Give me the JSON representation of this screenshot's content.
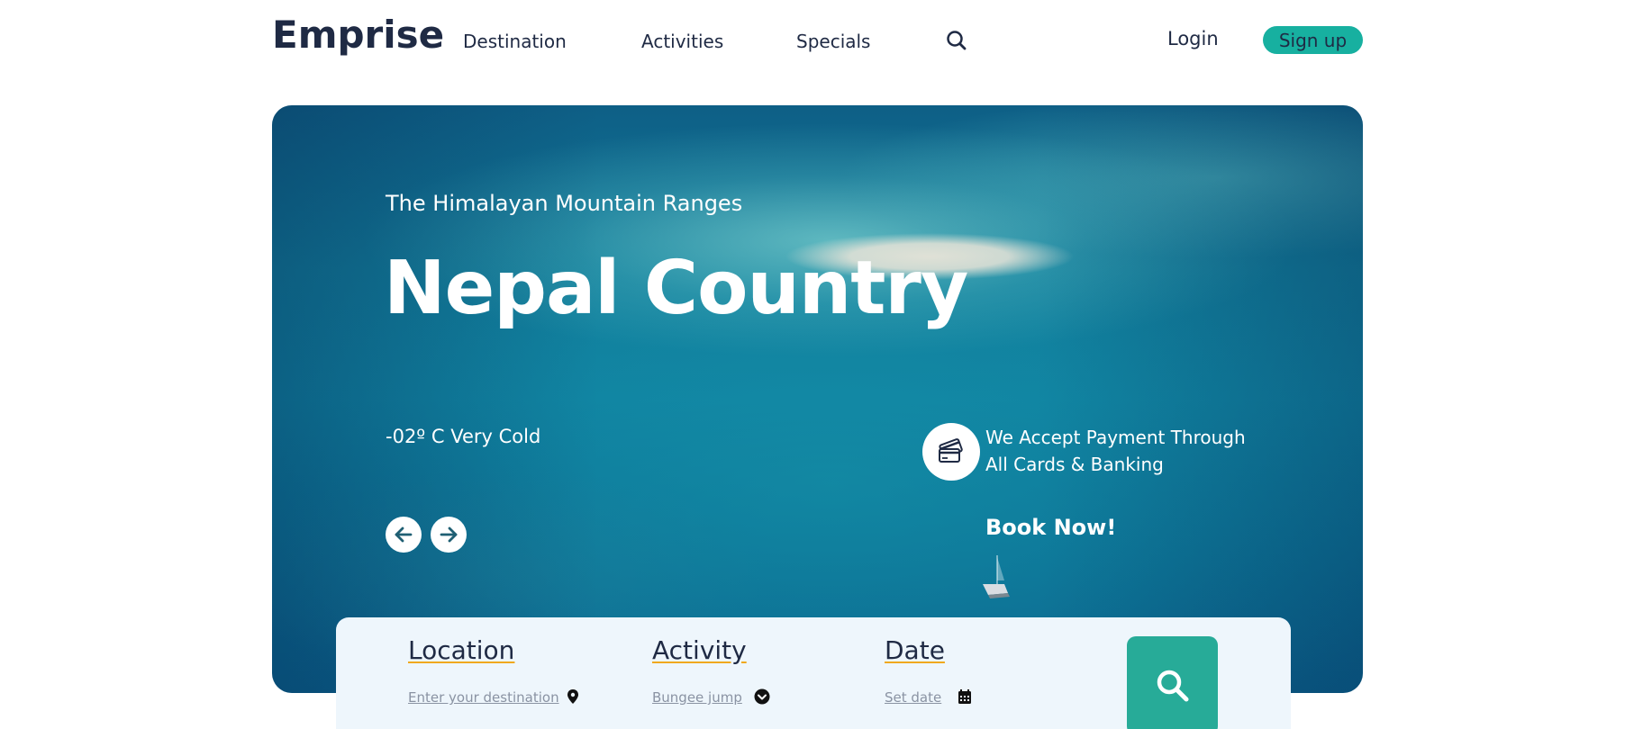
{
  "header": {
    "logo": "Emprise",
    "nav": [
      {
        "label": "Destination"
      },
      {
        "label": "Activities"
      },
      {
        "label": "Specials"
      }
    ],
    "search_icon": "search-icon",
    "login_label": "Login",
    "signup_label": "Sign up"
  },
  "hero": {
    "subtitle": "The Himalayan Mountain Ranges",
    "title": "Nepal Country",
    "temperature": "-02º C Very Cold",
    "payment_text_line1": "We Accept Payment Through",
    "payment_text_line2": "All Cards & Banking",
    "payment_icon": "credit-card-icon",
    "book_label": "Book Now!",
    "prev_icon": "arrow-left-icon",
    "next_icon": "arrow-right-icon"
  },
  "search_panel": {
    "location": {
      "label": "Location",
      "value": "Enter your destination",
      "icon": "map-pin-icon"
    },
    "activity": {
      "label": "Activity",
      "value": "Bungee jump",
      "icon": "chevron-down-icon"
    },
    "date": {
      "label": "Date",
      "value": "Set date",
      "icon": "calendar-icon"
    },
    "submit_icon": "search-icon"
  },
  "colors": {
    "accent": "#17b0a0",
    "search_button": "#27ab98",
    "text_dark": "#1f2a44",
    "underline": "#f0a91e",
    "panel_bg": "#eef6fc"
  }
}
